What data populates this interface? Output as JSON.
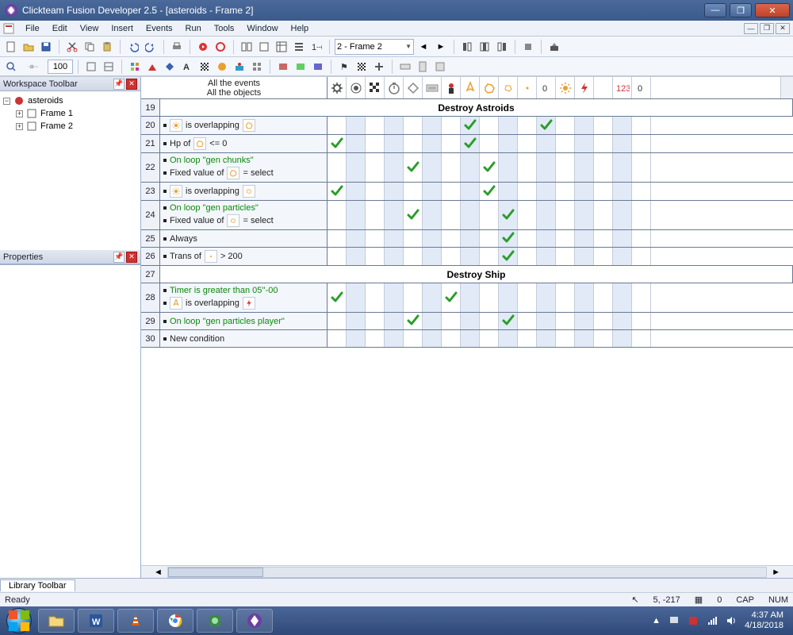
{
  "window": {
    "title": "Clickteam Fusion Developer 2.5 - [asteroids - Frame 2]"
  },
  "menu": {
    "items": [
      "File",
      "Edit",
      "View",
      "Insert",
      "Events",
      "Run",
      "Tools",
      "Window",
      "Help"
    ]
  },
  "toolbar": {
    "frame_selector": "2 - Frame 2",
    "zoom": "100"
  },
  "workspace": {
    "panel_title": "Workspace Toolbar",
    "root": "asteroids",
    "frames": [
      "Frame 1",
      "Frame 2"
    ]
  },
  "properties": {
    "panel_title": "Properties"
  },
  "events": {
    "header_top": "All the events",
    "header_bottom": "All the objects",
    "objects": [
      "gear",
      "gear2",
      "checker",
      "timer",
      "keys",
      "keyboard",
      "player",
      "ship",
      "asteroid",
      "chunk",
      "dot",
      "zero",
      "sun",
      "bolt",
      "blank",
      "num123",
      "zero2"
    ],
    "rows": [
      {
        "n": 19,
        "type": "group",
        "label": "Destroy Astroids"
      },
      {
        "n": 20,
        "type": "cond",
        "lines": [
          {
            "kind": "obj",
            "pre": "",
            "icon": "sun",
            "mid": "is overlapping",
            "icon2": "asteroid"
          }
        ],
        "checks": [
          8,
          12
        ]
      },
      {
        "n": 21,
        "type": "cond",
        "lines": [
          {
            "kind": "text",
            "pre": "Hp of",
            "icon": "asteroid",
            "mid": "<= 0"
          }
        ],
        "checks": [
          1,
          8
        ]
      },
      {
        "n": 22,
        "type": "cond",
        "lines": [
          {
            "kind": "green",
            "text": "On loop \"gen chunks\""
          },
          {
            "kind": "text",
            "pre": "Fixed value of",
            "icon": "asteroid",
            "mid": "= select"
          }
        ],
        "checks": [
          5,
          9
        ]
      },
      {
        "n": 23,
        "type": "cond",
        "lines": [
          {
            "kind": "obj",
            "pre": "",
            "icon": "sun",
            "mid": "is overlapping",
            "icon2": "chunk"
          }
        ],
        "checks": [
          1,
          9
        ]
      },
      {
        "n": 24,
        "type": "cond",
        "lines": [
          {
            "kind": "green",
            "text": "On loop \"gen particles\""
          },
          {
            "kind": "text",
            "pre": "Fixed value of",
            "icon": "chunk",
            "mid": "= select"
          }
        ],
        "checks": [
          5,
          10
        ]
      },
      {
        "n": 25,
        "type": "cond",
        "lines": [
          {
            "kind": "plain",
            "text": "Always"
          }
        ],
        "checks": [
          10
        ]
      },
      {
        "n": 26,
        "type": "cond",
        "lines": [
          {
            "kind": "text",
            "pre": "Trans of",
            "icon": "dot",
            "mid": "> 200"
          }
        ],
        "checks": [
          10
        ]
      },
      {
        "n": 27,
        "type": "group",
        "label": "Destroy Ship"
      },
      {
        "n": 28,
        "type": "cond",
        "lines": [
          {
            "kind": "green",
            "text": "Timer is greater than 05''-00"
          },
          {
            "kind": "obj",
            "pre": "",
            "icon": "ship",
            "mid": "is overlapping",
            "icon2": "bolt"
          }
        ],
        "checks": [
          1,
          7
        ]
      },
      {
        "n": 29,
        "type": "cond",
        "lines": [
          {
            "kind": "green",
            "text": "On loop \"gen particles player\""
          }
        ],
        "checks": [
          5,
          10
        ]
      },
      {
        "n": 30,
        "type": "cond",
        "lines": [
          {
            "kind": "plain",
            "text": "New condition"
          }
        ],
        "checks": []
      }
    ]
  },
  "library": {
    "tab": "Library Toolbar"
  },
  "status": {
    "ready": "Ready",
    "coords": "5, -217",
    "zoom": "0",
    "cap": "CAP",
    "num": "NUM"
  },
  "taskbar": {
    "time": "4:37 AM",
    "date": "4/18/2018"
  }
}
